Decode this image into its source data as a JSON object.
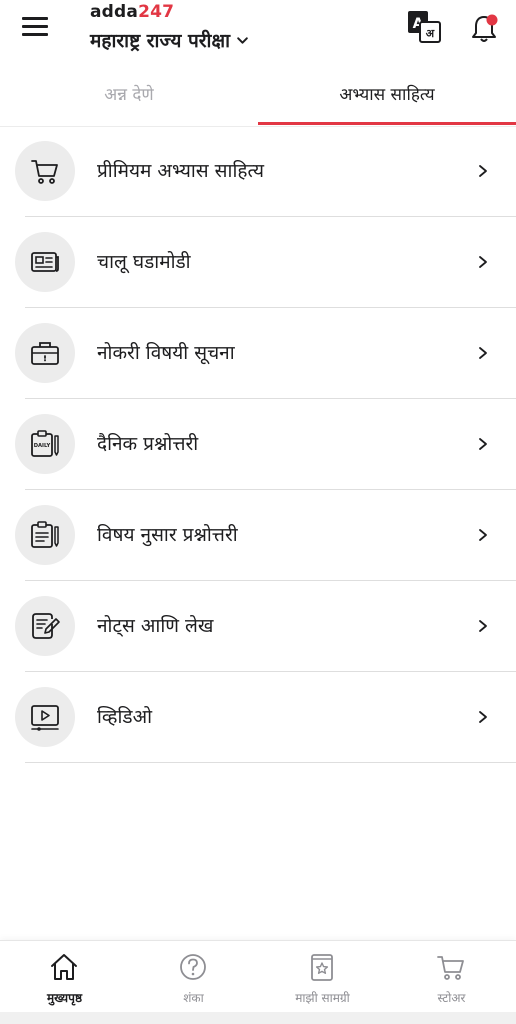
{
  "header": {
    "logo_text": "adda",
    "logo_num": "247",
    "exam_title": "महाराष्ट्र राज्य परीक्षा",
    "lang_icon": "translate-icon",
    "bell_icon": "notification-bell-icon",
    "accent_color": "#e23744"
  },
  "tabs": [
    {
      "label": "अन्न देणे",
      "active": false
    },
    {
      "label": "अभ्यास साहित्य",
      "active": true
    }
  ],
  "items": [
    {
      "label": "प्रीमियम अभ्यास साहित्य",
      "icon": "cart-icon"
    },
    {
      "label": "चालू घडामोडी",
      "icon": "newspaper-icon"
    },
    {
      "label": "नोकरी विषयी सूचना",
      "icon": "briefcase-icon"
    },
    {
      "label": "दैनिक प्रश्नोत्तरी",
      "icon": "daily-quiz-icon",
      "icon_text": "DAILY"
    },
    {
      "label": "विषय नुसार प्रश्नोत्तरी",
      "icon": "clipboard-icon"
    },
    {
      "label": "नोट्स आणि लेख",
      "icon": "notes-edit-icon"
    },
    {
      "label": "व्हिडिओ",
      "icon": "video-icon"
    }
  ],
  "bottom_nav": [
    {
      "label": "मुख्यपृष्ठ",
      "icon": "home-icon",
      "active": true
    },
    {
      "label": "शंका",
      "icon": "question-icon",
      "active": false
    },
    {
      "label": "माझी सामग्री",
      "icon": "my-content-icon",
      "active": false
    },
    {
      "label": "स्टोअर",
      "icon": "store-cart-icon",
      "active": false
    }
  ]
}
